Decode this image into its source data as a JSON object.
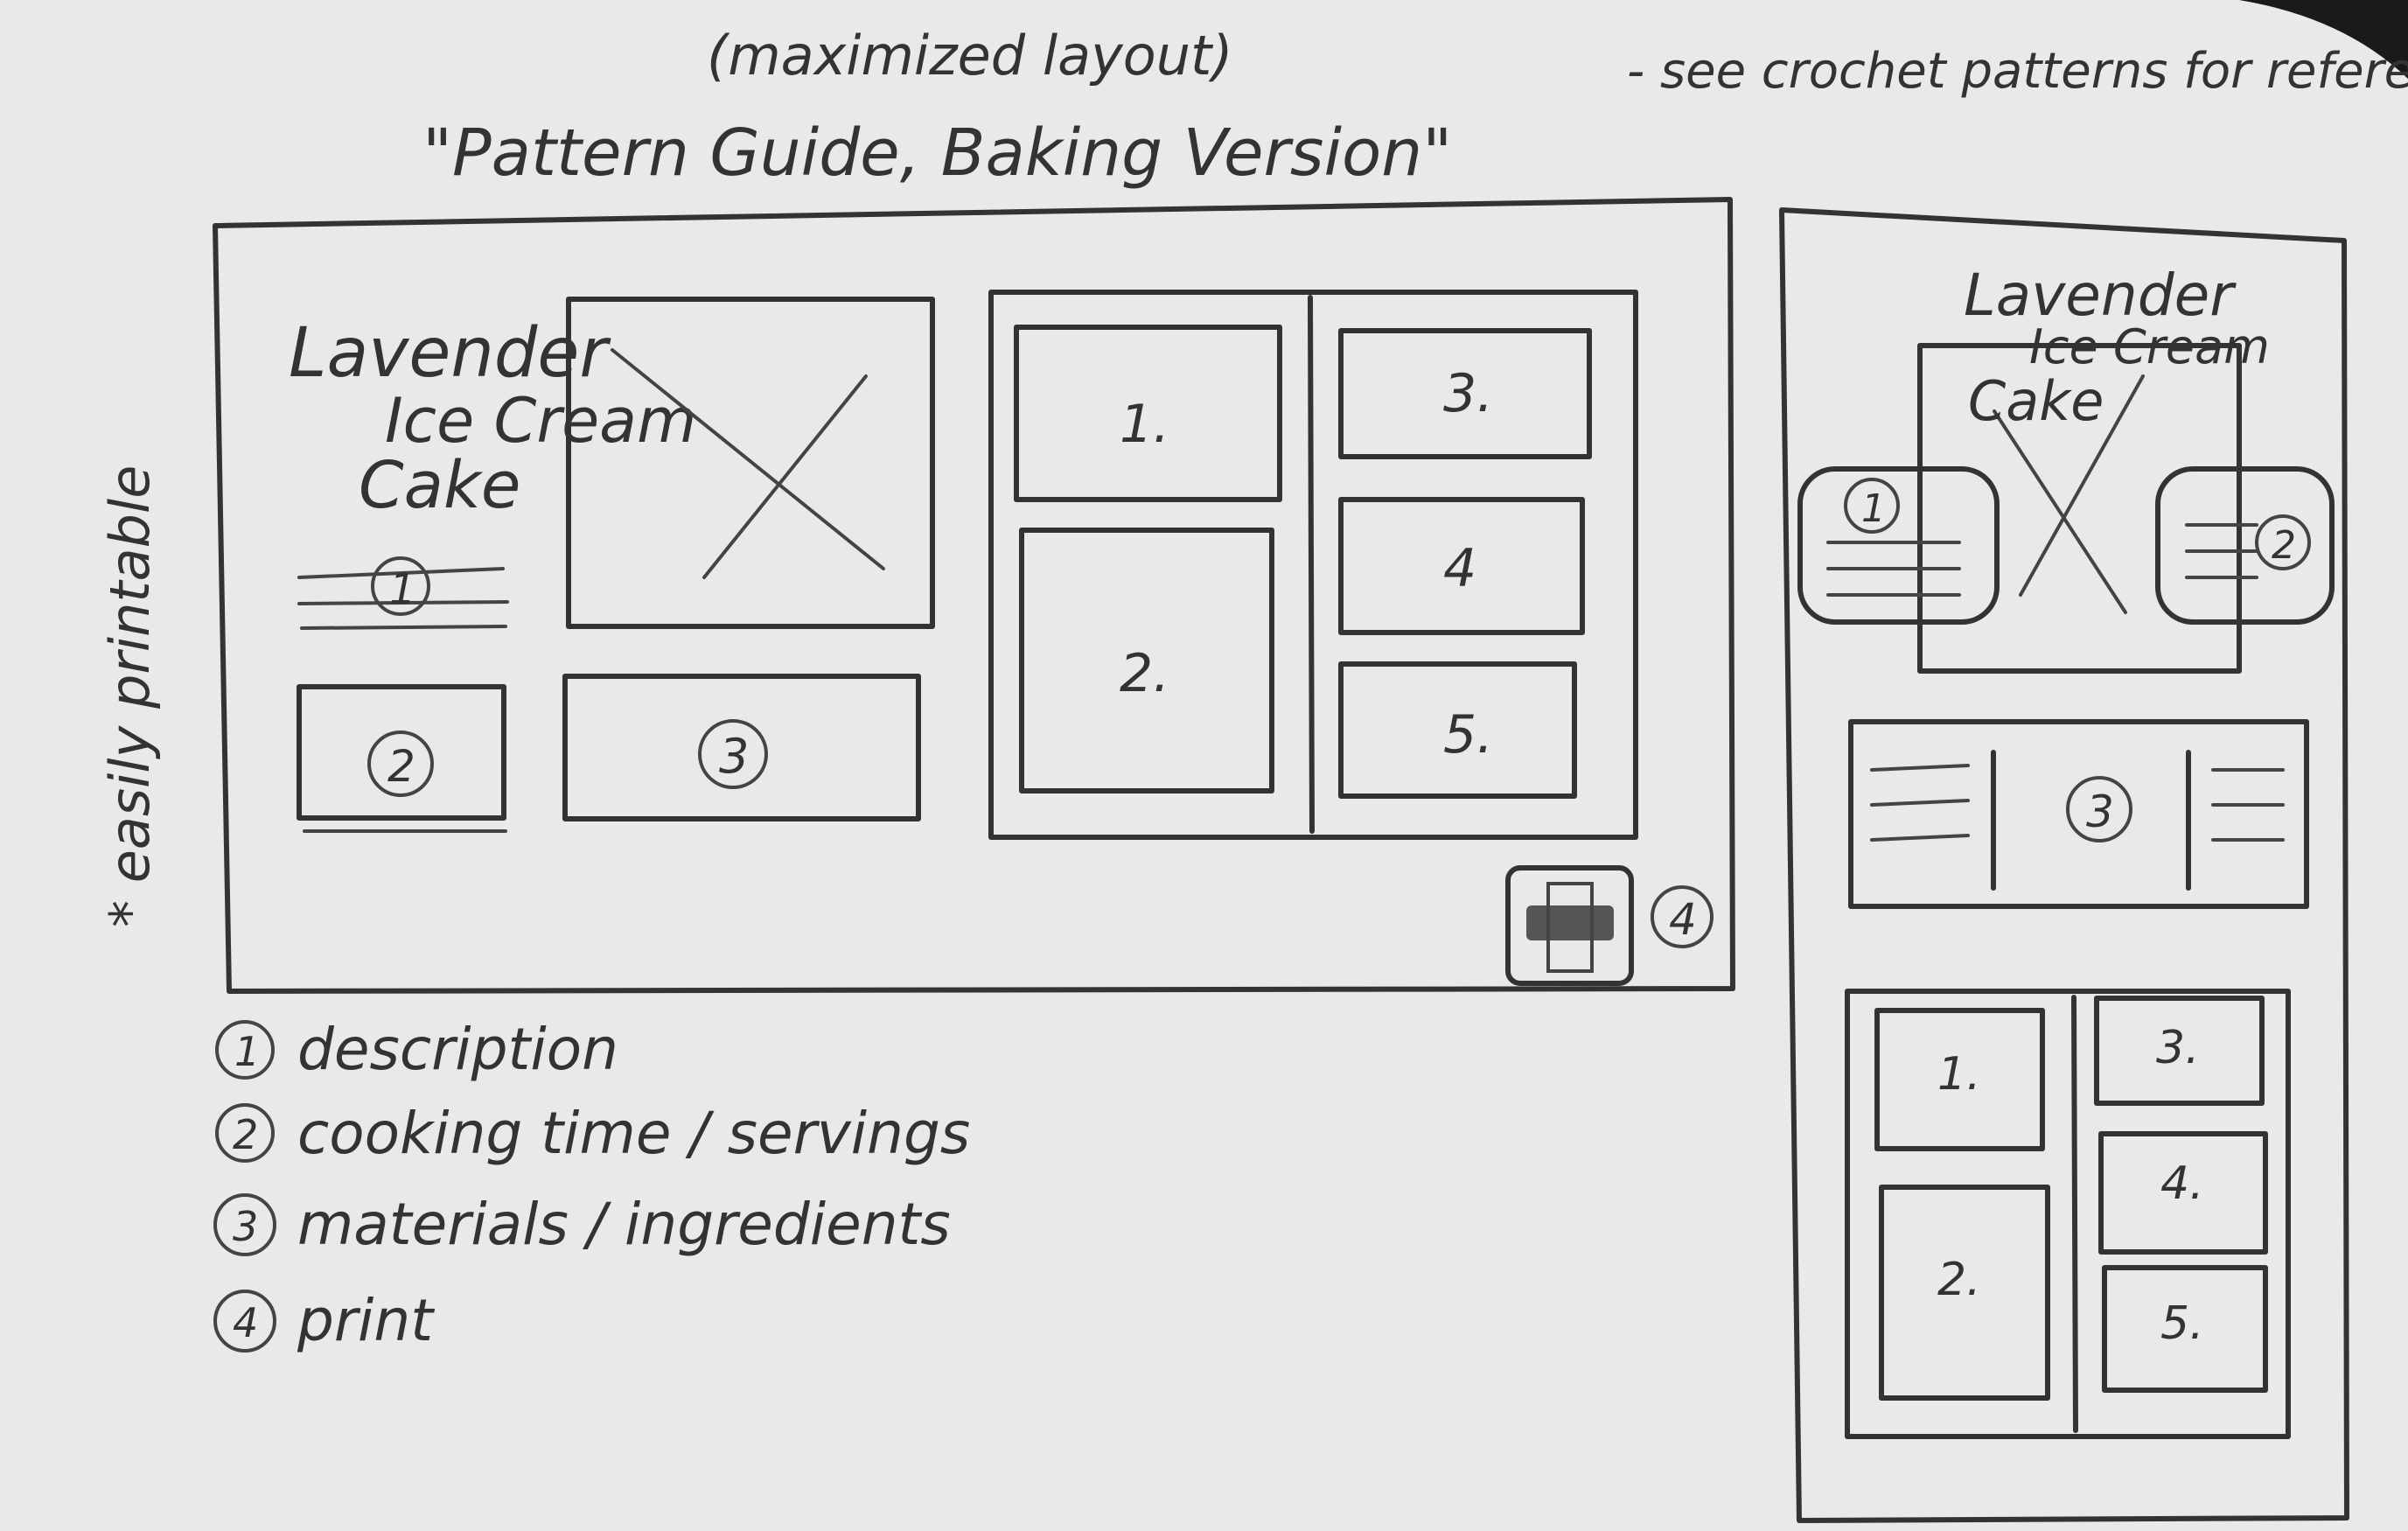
{
  "notes": {
    "heading": "(maximized layout)",
    "title": "\"Pattern Guide, Baking Version\"",
    "reference": "- see crochet patterns for reference",
    "side_note": "* easily printable"
  },
  "recipe": {
    "title_line1": "Lavender",
    "title_line2": "Ice Cream",
    "title_line3": "Cake"
  },
  "markers": {
    "m1": "1",
    "m2": "2",
    "m3": "3",
    "m4": "4"
  },
  "steps": [
    "1.",
    "2.",
    "3.",
    "4",
    "5."
  ],
  "mobile_steps": [
    "1.",
    "2.",
    "3.",
    "4.",
    "5."
  ],
  "legend": [
    {
      "number": "1",
      "label": "description"
    },
    {
      "number": "2",
      "label": "cooking time / servings"
    },
    {
      "number": "3",
      "label": "materials / ingredients"
    },
    {
      "number": "4",
      "label": "print"
    }
  ],
  "colors": {
    "paper": "#e9e9e7",
    "pencil": "#333333"
  }
}
